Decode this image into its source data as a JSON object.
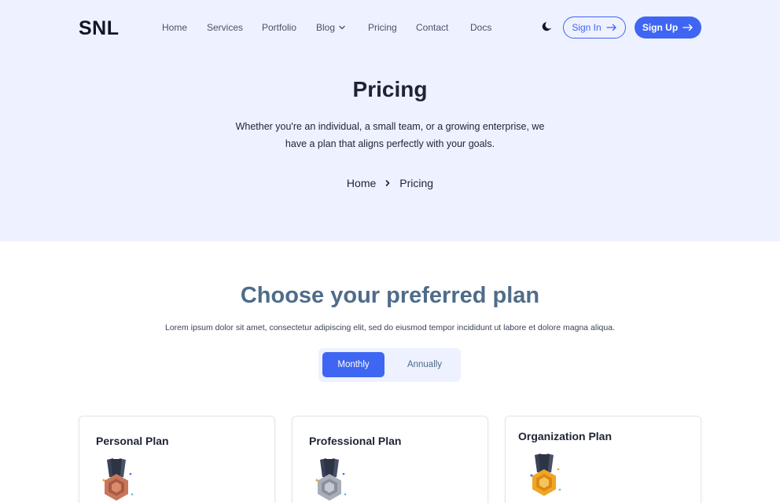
{
  "header": {
    "logo": "SNL",
    "nav": [
      {
        "label": "Home"
      },
      {
        "label": "Services"
      },
      {
        "label": "Portfolio"
      },
      {
        "label": "Blog",
        "has_dropdown": true
      },
      {
        "label": "Pricing"
      },
      {
        "label": "Contact"
      },
      {
        "label": "Docs"
      }
    ],
    "theme_icon": "moon-icon",
    "sign_in": "Sign In",
    "sign_up": "Sign Up"
  },
  "hero": {
    "title": "Pricing",
    "subtitle": "Whether you're an individual, a small team, or a growing enterprise, we have a plan that aligns perfectly with your goals.",
    "breadcrumb": [
      "Home",
      "Pricing"
    ]
  },
  "pricing": {
    "title": "Choose your preferred plan",
    "subtitle": "Lorem ipsum dolor sit amet, consectetur adipiscing elit, sed do eiusmod tempor incididunt ut labore et dolore magna aliqua.",
    "toggle": {
      "monthly": "Monthly",
      "annually": "Annually",
      "selected": "Monthly"
    },
    "plans": [
      {
        "name": "Personal Plan",
        "medal": "bronze-medal-icon"
      },
      {
        "name": "Professional Plan",
        "medal": "silver-medal-icon"
      },
      {
        "name": "Organization Plan",
        "medal": "gold-medal-icon"
      }
    ]
  },
  "colors": {
    "accent": "#3f66f2",
    "hero_bg": "#eef1ff",
    "section_title": "#4f6c8a",
    "bronze": "#c9775a",
    "silver": "#a9adb8",
    "gold": "#f0a526"
  }
}
